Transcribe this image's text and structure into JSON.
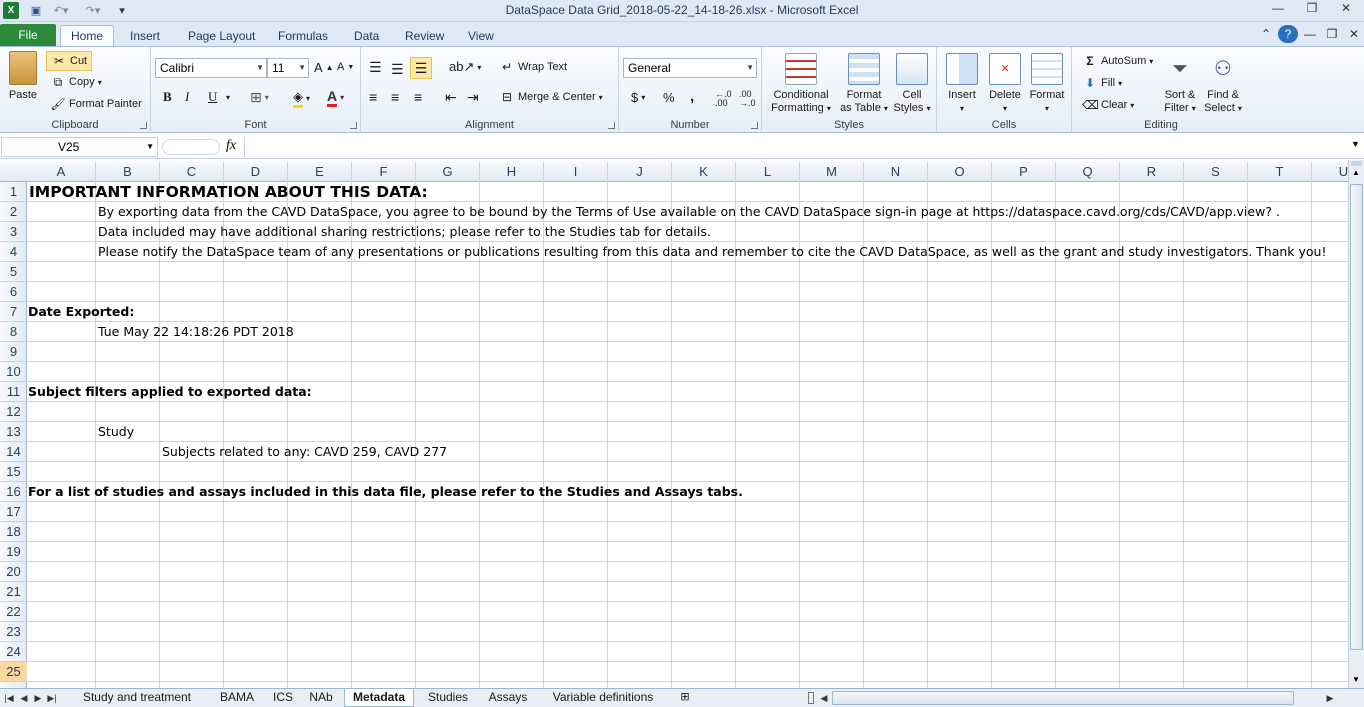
{
  "window": {
    "title": "DataSpace Data Grid_2018-05-22_14-18-26.xlsx - Microsoft Excel"
  },
  "ribbon_tabs": [
    "File",
    "Home",
    "Insert",
    "Page Layout",
    "Formulas",
    "Data",
    "Review",
    "View"
  ],
  "clipboard": {
    "paste": "Paste",
    "cut": "Cut",
    "copy": "Copy",
    "format_painter": "Format Painter",
    "label": "Clipboard"
  },
  "font": {
    "name": "Calibri",
    "size": "11",
    "label": "Font",
    "bold": "B",
    "italic": "I",
    "underline": "U"
  },
  "alignment": {
    "wrap_text": "Wrap Text",
    "merge_center": "Merge & Center",
    "label": "Alignment"
  },
  "number": {
    "format": "General",
    "currency": "$",
    "percent": "%",
    "comma": ",",
    "inc": "←.0 .00",
    "dec": ".00 →.0",
    "label": "Number"
  },
  "styles": {
    "conditional": "Conditional",
    "formatting": "Formatting",
    "format": "Format",
    "as_table": "as Table",
    "cell": "Cell",
    "cell_styles": "Styles",
    "label": "Styles"
  },
  "cells": {
    "insert": "Insert",
    "delete": "Delete",
    "format": "Format",
    "label": "Cells"
  },
  "editing": {
    "autosum": "AutoSum",
    "fill": "Fill",
    "clear": "Clear",
    "sort": "Sort &",
    "filter": "Filter",
    "find": "Find &",
    "select": "Select",
    "label": "Editing"
  },
  "formula_bar": {
    "name_box": "V25",
    "fx": "fx",
    "formula": ""
  },
  "columns": [
    "A",
    "B",
    "C",
    "D",
    "E",
    "F",
    "G",
    "H",
    "I",
    "J",
    "K",
    "L",
    "M",
    "N",
    "O",
    "P",
    "Q",
    "R",
    "S",
    "T",
    "U"
  ],
  "rows": [
    "1",
    "2",
    "3",
    "4",
    "5",
    "6",
    "7",
    "8",
    "9",
    "10",
    "11",
    "12",
    "13",
    "14",
    "15",
    "16",
    "17",
    "18",
    "19",
    "20",
    "21",
    "22",
    "23",
    "24",
    "25"
  ],
  "cells_content": {
    "r1": "IMPORTANT INFORMATION ABOUT THIS DATA:",
    "r2": "By exporting data from the CAVD DataSpace, you agree to be bound by the Terms of Use available on the CAVD DataSpace sign-in page at https://dataspace.cavd.org/cds/CAVD/app.view? .",
    "r3": "Data included may have additional sharing restrictions; please refer to the Studies tab for details.",
    "r4": "Please notify the DataSpace team of any presentations or publications resulting from this data and remember to cite the CAVD DataSpace, as well as the grant and study investigators. Thank you!",
    "r7": "Date Exported:",
    "r8": "Tue May 22 14:18:26 PDT 2018",
    "r11": "Subject filters applied to exported data:",
    "r13": "Study",
    "r14": "Subjects related to any: CAVD 259, CAVD 277",
    "r16": "For a list of studies and assays included in this data file, please refer to the Studies and Assays tabs."
  },
  "sheet_tabs": [
    "Study and treatment",
    "BAMA",
    "ICS",
    "NAb",
    "Metadata",
    "Studies",
    "Assays",
    "Variable definitions"
  ],
  "active_sheet": "Metadata",
  "selected_row": "25"
}
